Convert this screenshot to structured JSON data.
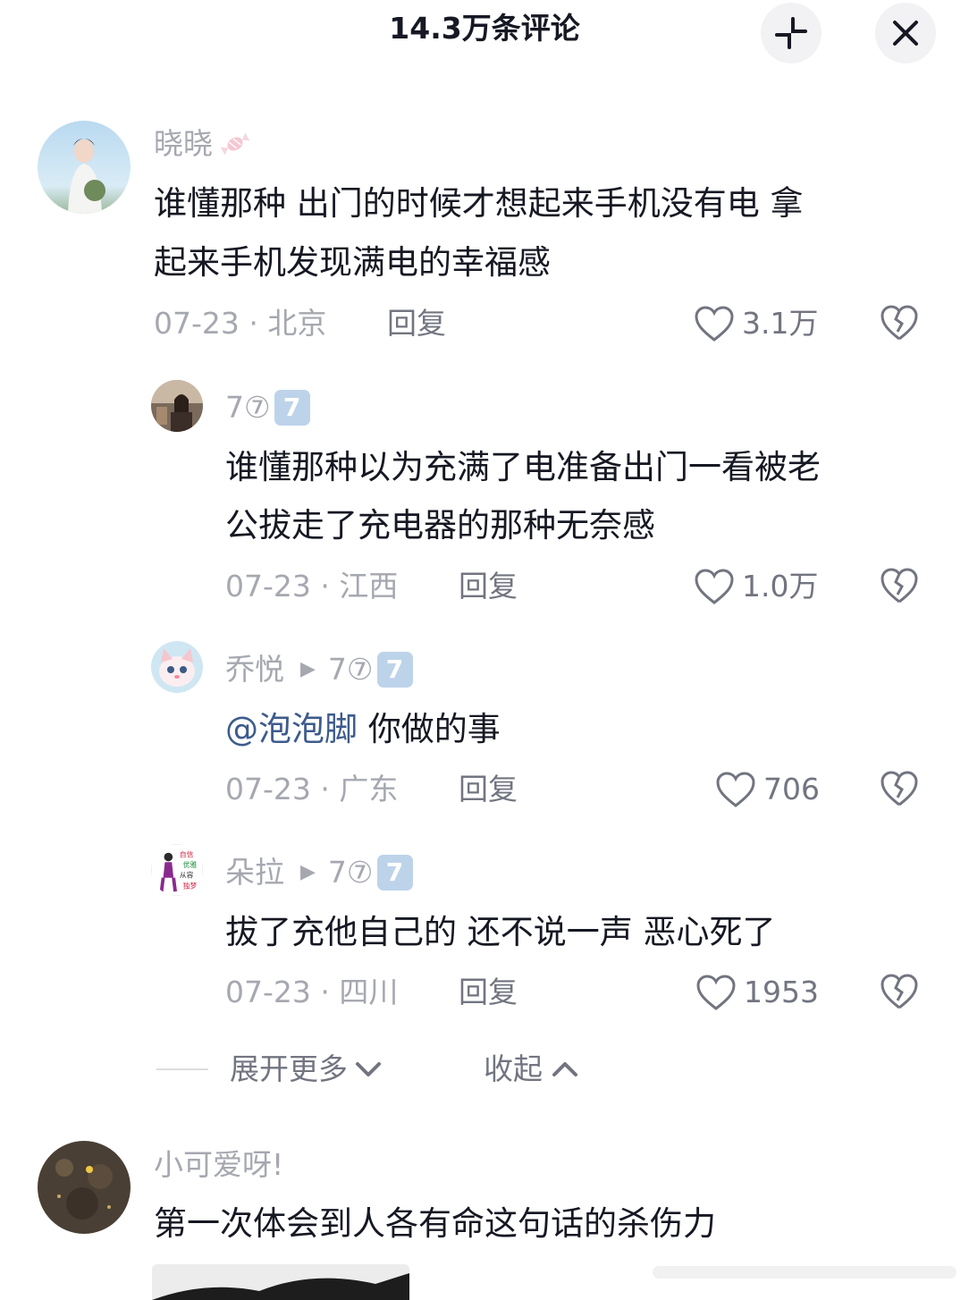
{
  "header": {
    "title": "14.3万条评论",
    "minimize_icon": "minimize-icon",
    "close_icon": "close-icon"
  },
  "comments": [
    {
      "username": "晓晓",
      "badge_icon": "candy-icon",
      "lines": [
        "谁懂那种 出门的时候才想起来手机没有电  拿",
        "起来手机发现满电的幸福感"
      ],
      "date": "07-23",
      "location": "北京",
      "reply_label": "回复",
      "likes": "3.1万"
    },
    {
      "username": "7⑦",
      "tag": "7",
      "lines": [
        "谁懂那种以为充满了电准备出门一看被老",
        "公拔走了充电器的那种无奈感"
      ],
      "date": "07-23",
      "location": "江西",
      "reply_label": "回复",
      "likes": "1.0万"
    },
    {
      "username": "乔悦",
      "reply_to": "7⑦",
      "tag": "7",
      "mention": "@泡泡脚",
      "text": " 你做的事",
      "date": "07-23",
      "location": "广东",
      "reply_label": "回复",
      "likes": "706"
    },
    {
      "username": "朵拉",
      "reply_to": "7⑦",
      "tag": "7",
      "text": "拔了充他自己的 还不说一声 恶心死了",
      "avatar_text": [
        "自信",
        "优雅",
        "从容",
        "独梦"
      ],
      "date": "07-23",
      "location": "四川",
      "reply_label": "回复",
      "likes": "1953"
    },
    {
      "username": "小可爱呀!",
      "text": "第一次体会到人各有命这句话的杀伤力"
    }
  ],
  "expand": {
    "more_label": "展开更多",
    "collapse_label": "收起"
  },
  "meta_sep": " · ",
  "colors": {
    "mention": "#3d5b8c",
    "meta": "#a6a8b0",
    "tag_bg": "#bdd3ea"
  }
}
